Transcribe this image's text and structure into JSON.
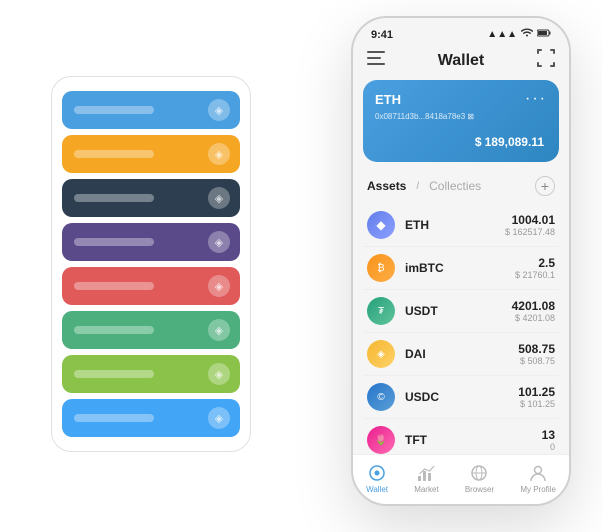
{
  "app": {
    "title": "Wallet"
  },
  "status_bar": {
    "time": "9:41",
    "signal": "▲▲▲",
    "wifi": "WiFi",
    "battery": "🔋"
  },
  "header": {
    "menu_icon": "≡",
    "title": "Wallet",
    "scan_icon": "⊡"
  },
  "eth_card": {
    "title": "ETH",
    "dots": "···",
    "address": "0x08711d3b...8418a78e3 ⊠",
    "currency": "$",
    "amount": "189,089.11"
  },
  "assets_section": {
    "tab_active": "Assets",
    "separator": "/",
    "tab_inactive": "Collecties",
    "add_icon": "+"
  },
  "assets": [
    {
      "name": "ETH",
      "amount_primary": "1004.01",
      "amount_secondary": "$ 162517.48",
      "icon_type": "eth"
    },
    {
      "name": "imBTC",
      "amount_primary": "2.5",
      "amount_secondary": "$ 21760.1",
      "icon_type": "imbtc"
    },
    {
      "name": "USDT",
      "amount_primary": "4201.08",
      "amount_secondary": "$ 4201.08",
      "icon_type": "usdt"
    },
    {
      "name": "DAI",
      "amount_primary": "508.75",
      "amount_secondary": "$ 508.75",
      "icon_type": "dai"
    },
    {
      "name": "USDC",
      "amount_primary": "101.25",
      "amount_secondary": "$ 101.25",
      "icon_type": "usdc"
    },
    {
      "name": "TFT",
      "amount_primary": "13",
      "amount_secondary": "0",
      "icon_type": "tft"
    }
  ],
  "bottom_nav": [
    {
      "label": "Wallet",
      "icon": "◎",
      "active": true
    },
    {
      "label": "Market",
      "icon": "⊞",
      "active": false
    },
    {
      "label": "Browser",
      "icon": "⊙",
      "active": false
    },
    {
      "label": "My Profile",
      "icon": "◷",
      "active": false
    }
  ],
  "card_stack": [
    {
      "color": "card-blue"
    },
    {
      "color": "card-orange"
    },
    {
      "color": "card-dark"
    },
    {
      "color": "card-purple"
    },
    {
      "color": "card-red"
    },
    {
      "color": "card-green"
    },
    {
      "color": "card-lightgreen"
    },
    {
      "color": "card-lightblue"
    }
  ]
}
